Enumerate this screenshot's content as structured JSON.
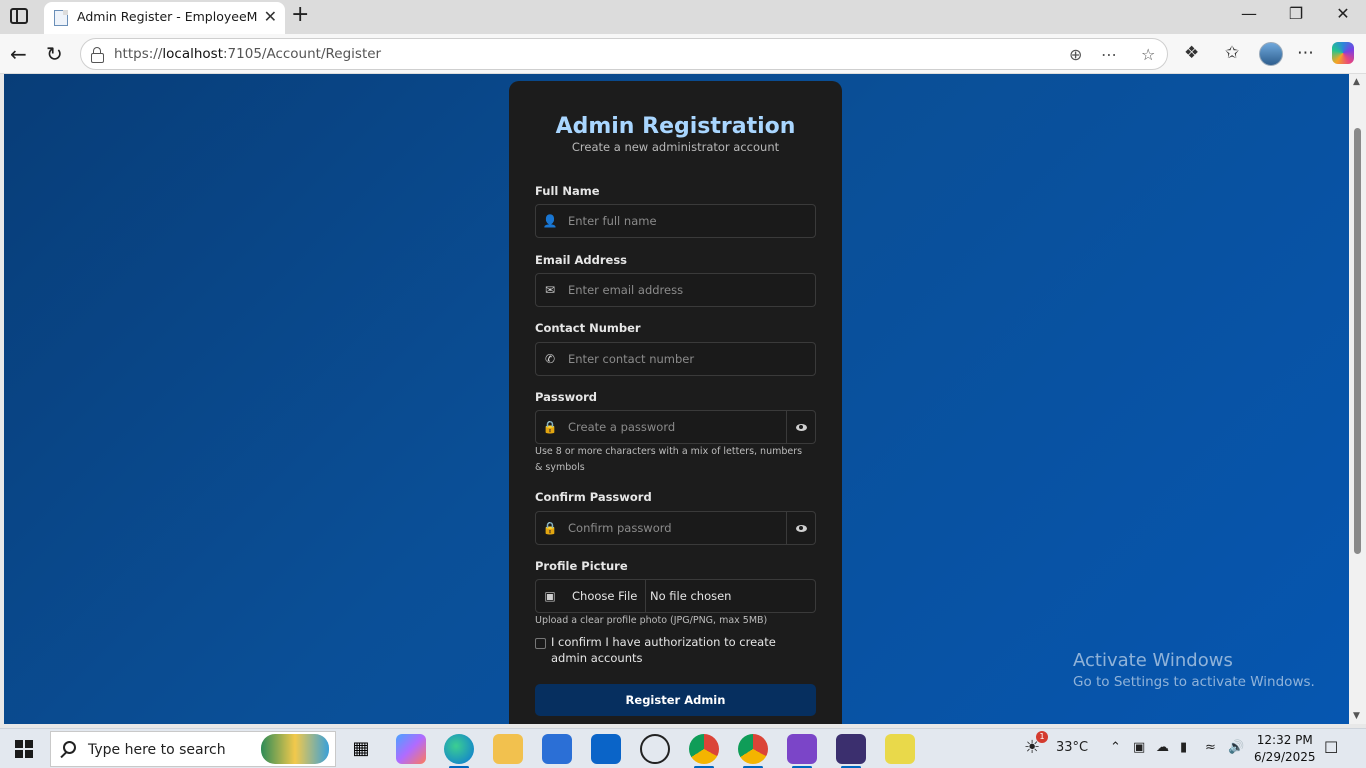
{
  "browser": {
    "tab_title": "Admin Register - EmployeeManag",
    "tab_close": "✕",
    "new_tab": "+",
    "url_scheme": "https://",
    "url_host": "localhost",
    "url_path": ":7105/Account/Register",
    "window_controls": {
      "minimize": "—",
      "maximize": "❐",
      "close": "✕"
    }
  },
  "page": {
    "title": "Admin Registration",
    "subtitle": "Create a new administrator account",
    "full_name": {
      "label": "Full Name",
      "placeholder": "Enter full name",
      "icon": "user-icon"
    },
    "email": {
      "label": "Email Address",
      "placeholder": "Enter email address",
      "icon": "envelope-icon"
    },
    "contact": {
      "label": "Contact Number",
      "placeholder": "Enter contact number",
      "icon": "phone-icon"
    },
    "password": {
      "label": "Password",
      "placeholder": "Create a password",
      "icon": "lock-icon",
      "hint": "Use 8 or more characters with a mix of letters, numbers & symbols"
    },
    "confirm_password": {
      "label": "Confirm Password",
      "placeholder": "Confirm password",
      "icon": "lock-icon"
    },
    "profile_picture": {
      "label": "Profile Picture",
      "button": "Choose File",
      "file_status": "No file chosen",
      "hint": "Upload a clear profile photo (JPG/PNG, max 5MB)",
      "icon": "image-icon"
    },
    "confirm_checkbox": {
      "label": "I confirm I have authorization to create admin accounts",
      "checked": false
    },
    "submit_label": "Register Admin",
    "colors": {
      "background": "#0a4f97",
      "card": "#1c1c1c",
      "title": "#a9d6ff",
      "button": "#062f5f"
    }
  },
  "watermark": {
    "line1": "Activate Windows",
    "line2": "Go to Settings to activate Windows."
  },
  "taskbar": {
    "search_placeholder": "Type here to search",
    "weather": "33°C",
    "weather_badge": "1",
    "time": "12:32 PM",
    "date": "6/29/2025"
  }
}
